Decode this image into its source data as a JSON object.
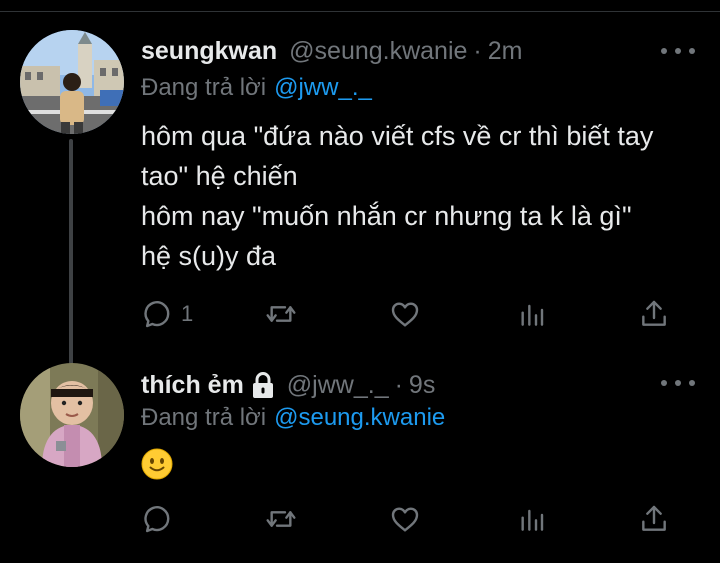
{
  "thread": [
    {
      "display_name": "seungkwan",
      "handle": "@seung.kwanie",
      "separator": "·",
      "time": "2m",
      "replying_prefix": "Đang trả lời",
      "replying_to": "@jww_._",
      "body_lines": [
        "hôm qua \"đứa nào viết cfs về cr thì biết tay",
        "tao\" hệ chiến",
        "hôm nay \"muốn nhắn cr nhưng ta k là gì\"",
        "hệ s(u)y đa"
      ],
      "reply_count": "1",
      "avatar_icon": "profile-photo-city-street",
      "protected": false
    },
    {
      "display_name": "thích ẻm",
      "handle": "@jww_._",
      "separator": "·",
      "time": "9s",
      "replying_prefix": "Đang trả lời",
      "replying_to": "@seung.kwanie",
      "body_emoji": "slightly-smiling-face",
      "reply_count": "",
      "avatar_icon": "profile-photo-child",
      "protected": true,
      "protected_icon": "lock-icon"
    }
  ],
  "colors": {
    "background": "#000000",
    "text_primary": "#e7e9ea",
    "text_secondary": "#71767b",
    "accent": "#1d9bf0",
    "thread_line": "#3e4144"
  }
}
